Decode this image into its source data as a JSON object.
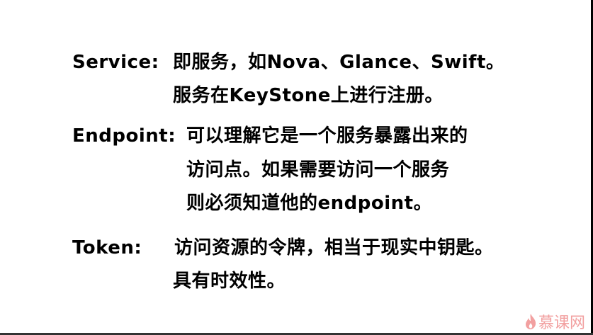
{
  "slide": {
    "service": {
      "label": "Service:",
      "lines": [
        "即服务，如Nova、Glance、Swift。",
        "服务在KeyStone上进行注册。"
      ]
    },
    "endpoint": {
      "label": "Endpoint:",
      "lines": [
        "可以理解它是一个服务暴露出来的",
        "访问点。如果需要访问一个服务",
        "则必须知道他的endpoint。"
      ]
    },
    "token": {
      "label": "Token:",
      "lines": [
        "访问资源的令牌，相当于现实中钥匙。",
        "具有时效性。"
      ]
    }
  },
  "watermark": {
    "text": "慕课网",
    "color": "#f2a0a0"
  }
}
